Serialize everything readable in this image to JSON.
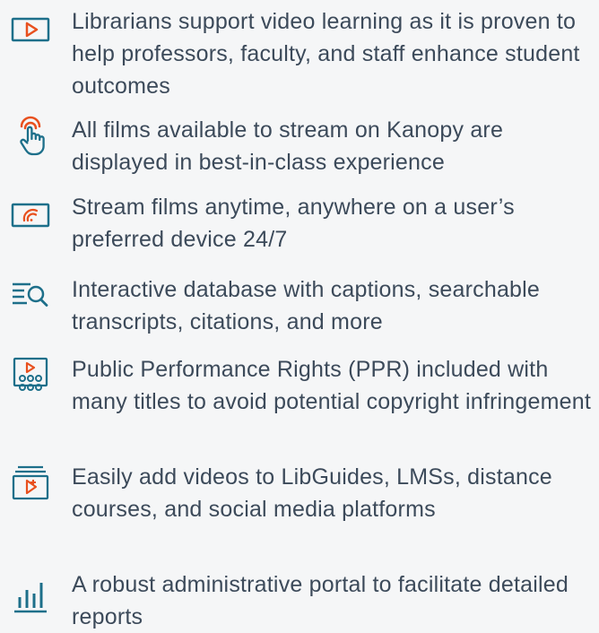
{
  "colors": {
    "text": "#3c4a5a",
    "icon_primary": "#1d6f8a",
    "icon_accent": "#e8501e",
    "background": "#f5f6f7"
  },
  "features": [
    {
      "icon": "video-play-icon",
      "text": "Librarians support video learning as it is proven to help professors, faculty, and staff enhance student outcomes"
    },
    {
      "icon": "touch-hand-icon",
      "text": "All films available to stream on Kanopy are displayed in best-in-class experience"
    },
    {
      "icon": "wireless-screen-icon",
      "text": "Stream films anytime, anywhere on a user’s preferred device 24/7"
    },
    {
      "icon": "list-search-icon",
      "text": "Interactive database with captions, searchable transcripts, citations, and more"
    },
    {
      "icon": "audience-screen-icon",
      "text": "Public Performance Rights (PPR) included with many titles to avoid potential copyright infringement"
    },
    {
      "icon": "add-video-icon",
      "text": "Easily add videos to LibGuides, LMSs, distance courses, and social media platforms"
    },
    {
      "icon": "bar-chart-icon",
      "text": "A robust administrative portal to facilitate detailed reports"
    }
  ]
}
